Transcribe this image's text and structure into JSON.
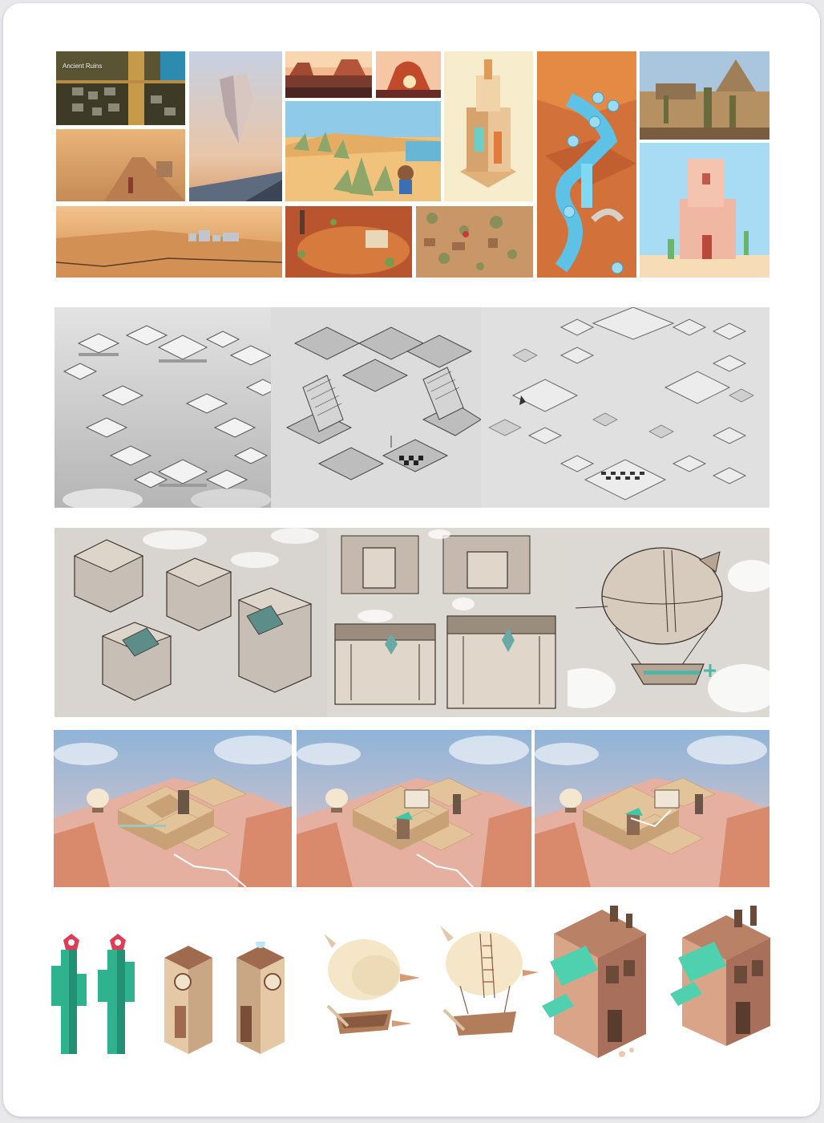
{
  "moodboard": {
    "caption": "Ancient Ruins"
  },
  "palette": {
    "sand": "#e6a35a",
    "terracotta": "#c97a4a",
    "sky": "#a9c6de",
    "teal": "#3fc7a6",
    "cream": "#f3e7d0",
    "sketch_bg": "#d9d6d3",
    "wire_bg": "#dcdcdc"
  }
}
